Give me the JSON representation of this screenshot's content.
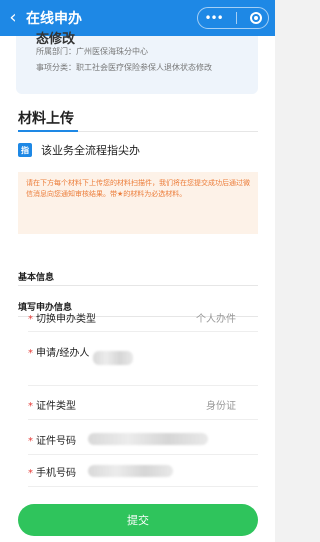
{
  "header": {
    "back_icon": "‹",
    "title": "在线申办",
    "more_dots": "•••"
  },
  "summary": {
    "heading_fragment": "态修改",
    "department": "所属部门：广州医保海珠分中心",
    "category": "事项分类：职工社会医疗保险参保人退休状态修改"
  },
  "materials": {
    "title": "材料上传",
    "guide_badge": "指",
    "guide_text": "该业务全流程指尖办",
    "notice": "请在下方每个材料下上传您的材料扫描件，我们将在您提交成功后通过微信消息向您通知审核结果。带★的材料为必选材料。"
  },
  "form": {
    "basic_info_title": "基本信息",
    "apply_info_title": "填写申办信息",
    "required_mark": "*",
    "fields": [
      {
        "label": "切换申办类型",
        "value": "个人办件"
      },
      {
        "label": "申请/经办人",
        "value": ""
      },
      {
        "label": "证件类型",
        "value": "身份证"
      },
      {
        "label": "证件号码",
        "value": ""
      },
      {
        "label": "手机号码",
        "value": ""
      }
    ]
  },
  "submit_label": "提交",
  "colors": {
    "primary": "#1e88e5",
    "success": "#2fc45c",
    "notice_text": "#ec7d3a",
    "required": "#e53935"
  }
}
